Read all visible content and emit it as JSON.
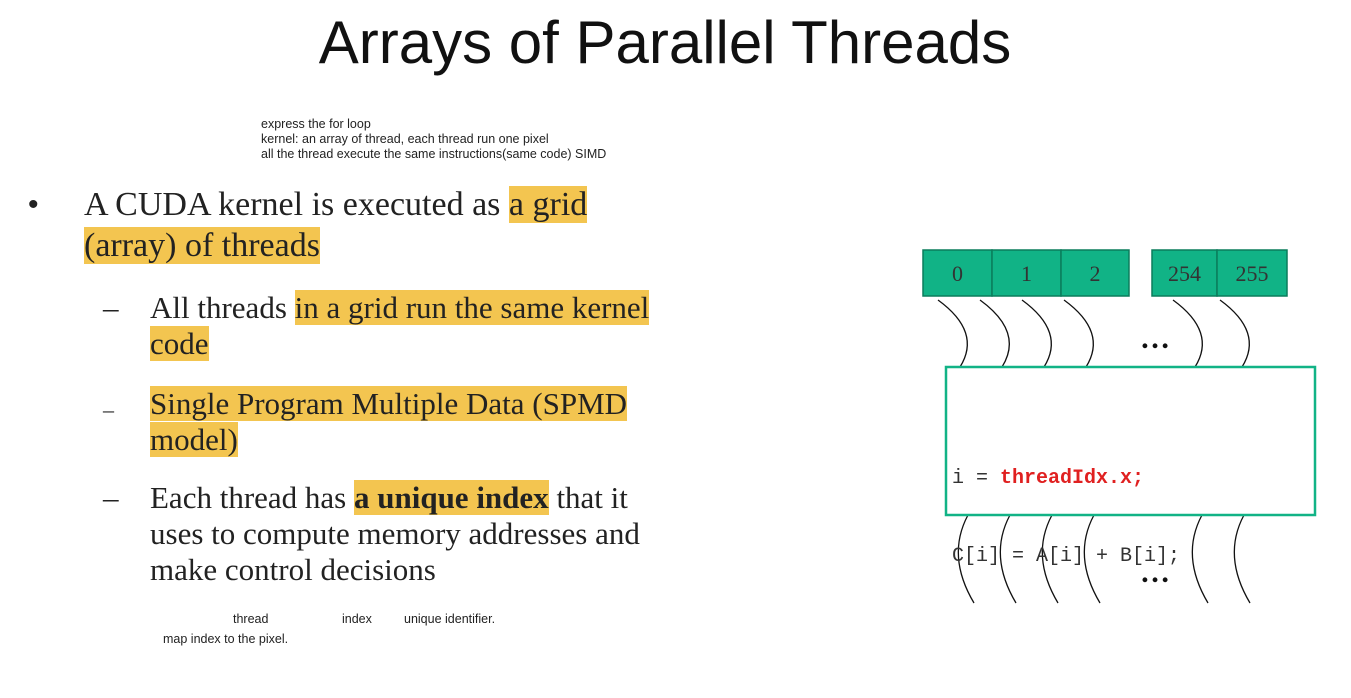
{
  "slide": {
    "title": "Arrays of Parallel Threads"
  },
  "notes": {
    "line1": "express the for loop",
    "line2": "kernel: an array of thread, each thread run one pixel",
    "line3": "all the thread execute the same instructions(same code) SIMD"
  },
  "bullet": {
    "text_plain": "A CUDA kernel is executed as ",
    "text_hl1": "a grid",
    "text_hl2": "(array) of threads"
  },
  "sub_bullets": [
    {
      "plain": "All threads ",
      "hl1": "in a grid run the same kernel",
      "hl2": "code"
    },
    {
      "hl1": "Single Program Multiple Data (SPMD",
      "hl2": "model)"
    },
    {
      "plain1": "Each thread has ",
      "bold": "a unique index",
      "plain2": " that it",
      "line2": "uses to compute memory addresses and",
      "line3": "make control decisions"
    }
  ],
  "bottom_notes": {
    "word1": "thread",
    "word2": "index",
    "word3": "unique identifier.",
    "line2": "map index to the pixel."
  },
  "diagram": {
    "cells": [
      "0",
      "1",
      "2",
      "254",
      "255"
    ],
    "ellipsis": "…",
    "code_line1_prefix": "i = ",
    "code_line1_highlight": "threadIdx.x;",
    "code_line2": "C[i] = A[i] + B[i];",
    "colors": {
      "cell_fill": "#11b386",
      "cell_stroke": "#0b7d5c",
      "box_stroke": "#11b386",
      "highlight": "#f3c550",
      "code_red": "#e02020"
    }
  }
}
